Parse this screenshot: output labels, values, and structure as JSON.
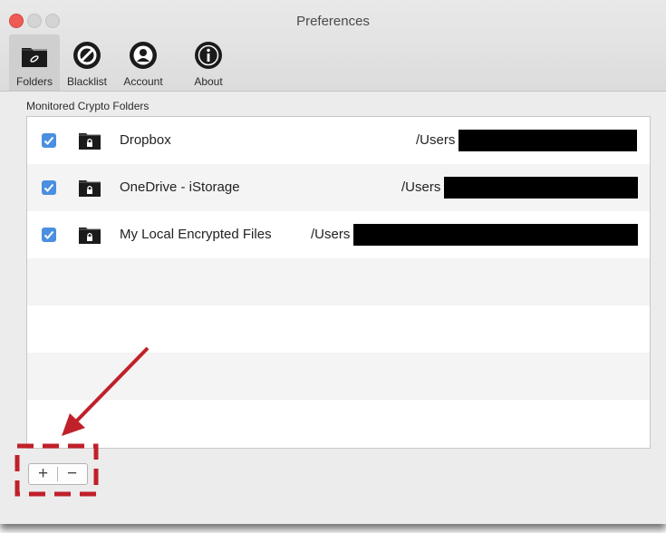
{
  "window": {
    "title": "Preferences"
  },
  "toolbar": {
    "items": [
      {
        "label": "Folders",
        "icon": "folder-lock-icon",
        "selected": true
      },
      {
        "label": "Blacklist",
        "icon": "prohibited-icon",
        "selected": false
      },
      {
        "label": "Account",
        "icon": "user-icon",
        "selected": false
      },
      {
        "label": "About",
        "icon": "info-icon",
        "selected": false
      }
    ]
  },
  "folders": {
    "section_label": "Monitored Crypto Folders",
    "rows": [
      {
        "name": "Dropbox",
        "path": "/Users",
        "checked": true
      },
      {
        "name": "OneDrive - iStorage",
        "path": "/Users",
        "checked": true
      },
      {
        "name": "My Local Encrypted Files",
        "path": "/Users",
        "checked": true
      }
    ]
  },
  "controls": {
    "add_label": "+",
    "remove_label": "−"
  },
  "colors": {
    "checkbox": "#4a8fe0",
    "annotation": "#c0202a",
    "close_button": "#ee5b55"
  }
}
